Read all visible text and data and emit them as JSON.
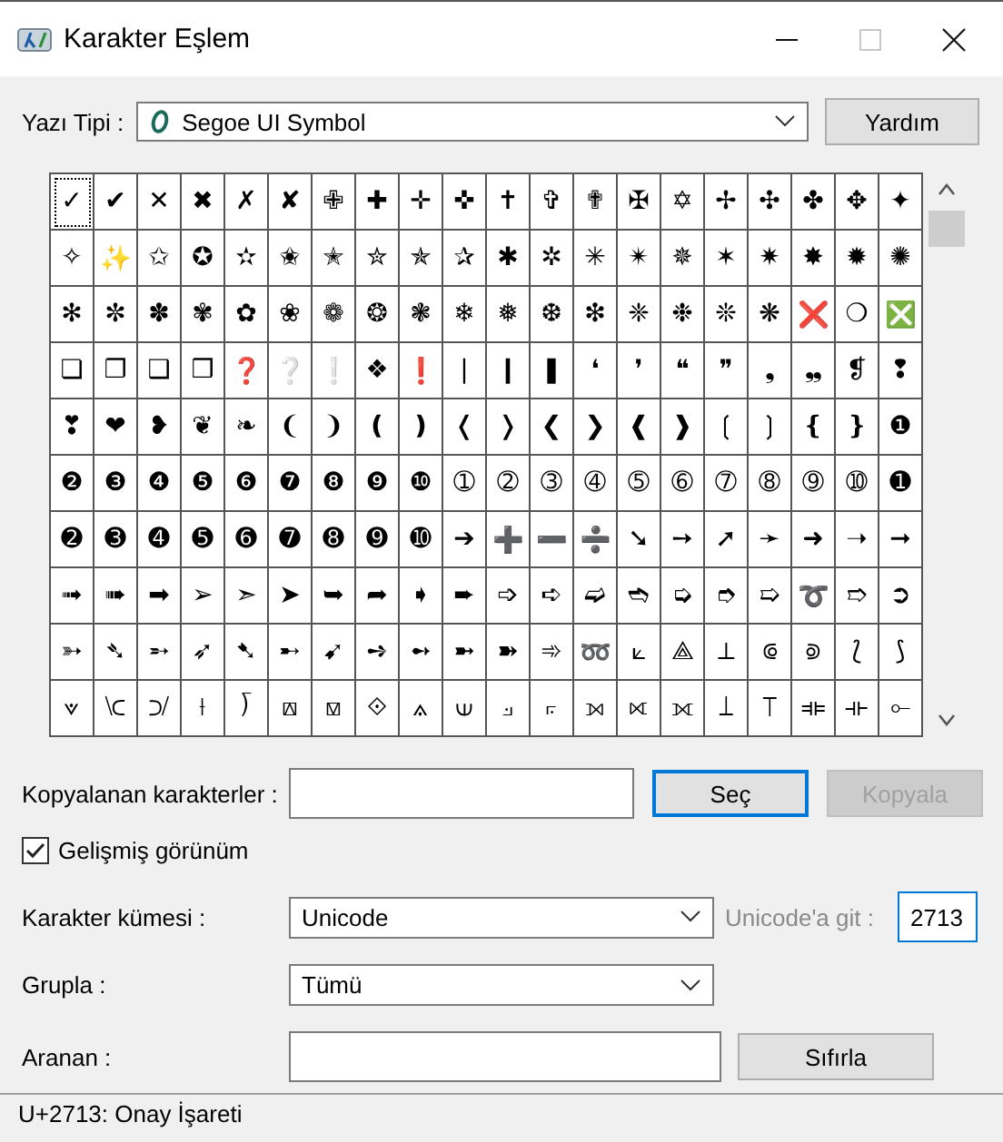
{
  "window": {
    "title": "Karakter Eşlem"
  },
  "font": {
    "label": "Yazı Tipi :",
    "value": "Segoe UI Symbol",
    "help_button": "Yardım"
  },
  "grid": [
    [
      {
        "char": "✓",
        "selected": true
      },
      {
        "char": "✔",
        "selected": false
      },
      {
        "char": "✕",
        "selected": false
      },
      {
        "char": "✖",
        "selected": false
      },
      {
        "char": "✗",
        "selected": false
      },
      {
        "char": "✘",
        "selected": false
      },
      {
        "char": "✙",
        "selected": false
      },
      {
        "char": "✚",
        "selected": false
      },
      {
        "char": "✛",
        "selected": false
      },
      {
        "char": "✜",
        "selected": false
      },
      {
        "char": "✝",
        "selected": false
      },
      {
        "char": "✞",
        "selected": false
      },
      {
        "char": "✟",
        "selected": false
      },
      {
        "char": "✠",
        "selected": false
      },
      {
        "char": "✡",
        "selected": false
      },
      {
        "char": "✢",
        "selected": false
      },
      {
        "char": "✣",
        "selected": false
      },
      {
        "char": "✤",
        "selected": false
      },
      {
        "char": "✥",
        "selected": false
      },
      {
        "char": "✦",
        "selected": false
      }
    ],
    [
      {
        "char": "✧",
        "selected": false
      },
      {
        "char": "✨",
        "selected": false
      },
      {
        "char": "✩",
        "selected": false
      },
      {
        "char": "✪",
        "selected": false
      },
      {
        "char": "✫",
        "selected": false
      },
      {
        "char": "✬",
        "selected": false
      },
      {
        "char": "✭",
        "selected": false
      },
      {
        "char": "✮",
        "selected": false
      },
      {
        "char": "✯",
        "selected": false
      },
      {
        "char": "✰",
        "selected": false
      },
      {
        "char": "✱",
        "selected": false
      },
      {
        "char": "✲",
        "selected": false
      },
      {
        "char": "✳",
        "selected": false
      },
      {
        "char": "✴",
        "selected": false
      },
      {
        "char": "✵",
        "selected": false
      },
      {
        "char": "✶",
        "selected": false
      },
      {
        "char": "✷",
        "selected": false
      },
      {
        "char": "✸",
        "selected": false
      },
      {
        "char": "✹",
        "selected": false
      },
      {
        "char": "✺",
        "selected": false
      }
    ],
    [
      {
        "char": "✻",
        "selected": false
      },
      {
        "char": "✼",
        "selected": false
      },
      {
        "char": "✽",
        "selected": false
      },
      {
        "char": "✾",
        "selected": false
      },
      {
        "char": "✿",
        "selected": false
      },
      {
        "char": "❀",
        "selected": false
      },
      {
        "char": "❁",
        "selected": false
      },
      {
        "char": "❂",
        "selected": false
      },
      {
        "char": "❃",
        "selected": false
      },
      {
        "char": "❄",
        "selected": false
      },
      {
        "char": "❅",
        "selected": false
      },
      {
        "char": "❆",
        "selected": false
      },
      {
        "char": "❇",
        "selected": false
      },
      {
        "char": "❈",
        "selected": false
      },
      {
        "char": "❉",
        "selected": false
      },
      {
        "char": "❊",
        "selected": false
      },
      {
        "char": "❋",
        "selected": false
      },
      {
        "char": "❌",
        "selected": false
      },
      {
        "char": "❍",
        "selected": false
      },
      {
        "char": "❎",
        "selected": false
      }
    ],
    [
      {
        "char": "❏",
        "selected": false
      },
      {
        "char": "❐",
        "selected": false
      },
      {
        "char": "❑",
        "selected": false
      },
      {
        "char": "❒",
        "selected": false
      },
      {
        "char": "❓",
        "selected": false
      },
      {
        "char": "❔",
        "selected": false
      },
      {
        "char": "❕",
        "selected": false
      },
      {
        "char": "❖",
        "selected": false
      },
      {
        "char": "❗",
        "selected": false
      },
      {
        "char": "❘",
        "selected": false
      },
      {
        "char": "❙",
        "selected": false
      },
      {
        "char": "❚",
        "selected": false
      },
      {
        "char": "❛",
        "selected": false
      },
      {
        "char": "❜",
        "selected": false
      },
      {
        "char": "❝",
        "selected": false
      },
      {
        "char": "❞",
        "selected": false
      },
      {
        "char": "❟",
        "selected": false
      },
      {
        "char": "❠",
        "selected": false
      },
      {
        "char": "❡",
        "selected": false
      },
      {
        "char": "❢",
        "selected": false
      }
    ],
    [
      {
        "char": "❣",
        "selected": false
      },
      {
        "char": "❤",
        "selected": false
      },
      {
        "char": "❥",
        "selected": false
      },
      {
        "char": "❦",
        "selected": false
      },
      {
        "char": "❧",
        "selected": false
      },
      {
        "char": "❨",
        "selected": false
      },
      {
        "char": "❩",
        "selected": false
      },
      {
        "char": "❪",
        "selected": false
      },
      {
        "char": "❫",
        "selected": false
      },
      {
        "char": "❬",
        "selected": false
      },
      {
        "char": "❭",
        "selected": false
      },
      {
        "char": "❮",
        "selected": false
      },
      {
        "char": "❯",
        "selected": false
      },
      {
        "char": "❰",
        "selected": false
      },
      {
        "char": "❱",
        "selected": false
      },
      {
        "char": "❲",
        "selected": false
      },
      {
        "char": "❳",
        "selected": false
      },
      {
        "char": "❴",
        "selected": false
      },
      {
        "char": "❵",
        "selected": false
      },
      {
        "char": "❶",
        "selected": false
      }
    ],
    [
      {
        "char": "❷",
        "selected": false
      },
      {
        "char": "❸",
        "selected": false
      },
      {
        "char": "❹",
        "selected": false
      },
      {
        "char": "❺",
        "selected": false
      },
      {
        "char": "❻",
        "selected": false
      },
      {
        "char": "❼",
        "selected": false
      },
      {
        "char": "❽",
        "selected": false
      },
      {
        "char": "❾",
        "selected": false
      },
      {
        "char": "❿",
        "selected": false
      },
      {
        "char": "➀",
        "selected": false
      },
      {
        "char": "➁",
        "selected": false
      },
      {
        "char": "➂",
        "selected": false
      },
      {
        "char": "➃",
        "selected": false
      },
      {
        "char": "➄",
        "selected": false
      },
      {
        "char": "➅",
        "selected": false
      },
      {
        "char": "➆",
        "selected": false
      },
      {
        "char": "➇",
        "selected": false
      },
      {
        "char": "➈",
        "selected": false
      },
      {
        "char": "➉",
        "selected": false
      },
      {
        "char": "➊",
        "selected": false
      }
    ],
    [
      {
        "char": "➋",
        "selected": false
      },
      {
        "char": "➌",
        "selected": false
      },
      {
        "char": "➍",
        "selected": false
      },
      {
        "char": "➎",
        "selected": false
      },
      {
        "char": "➏",
        "selected": false
      },
      {
        "char": "➐",
        "selected": false
      },
      {
        "char": "➑",
        "selected": false
      },
      {
        "char": "➒",
        "selected": false
      },
      {
        "char": "➓",
        "selected": false
      },
      {
        "char": "➔",
        "selected": false
      },
      {
        "char": "➕",
        "selected": false
      },
      {
        "char": "➖",
        "selected": false
      },
      {
        "char": "➗",
        "selected": false
      },
      {
        "char": "➘",
        "selected": false
      },
      {
        "char": "➙",
        "selected": false
      },
      {
        "char": "➚",
        "selected": false
      },
      {
        "char": "➛",
        "selected": false
      },
      {
        "char": "➜",
        "selected": false
      },
      {
        "char": "➝",
        "selected": false
      },
      {
        "char": "➞",
        "selected": false
      }
    ],
    [
      {
        "char": "➟",
        "selected": false
      },
      {
        "char": "➠",
        "selected": false
      },
      {
        "char": "➡",
        "selected": false
      },
      {
        "char": "➢",
        "selected": false
      },
      {
        "char": "➣",
        "selected": false
      },
      {
        "char": "➤",
        "selected": false
      },
      {
        "char": "➥",
        "selected": false
      },
      {
        "char": "➦",
        "selected": false
      },
      {
        "char": "➧",
        "selected": false
      },
      {
        "char": "➨",
        "selected": false
      },
      {
        "char": "➩",
        "selected": false
      },
      {
        "char": "➪",
        "selected": false
      },
      {
        "char": "➫",
        "selected": false
      },
      {
        "char": "➬",
        "selected": false
      },
      {
        "char": "➭",
        "selected": false
      },
      {
        "char": "➮",
        "selected": false
      },
      {
        "char": "➯",
        "selected": false
      },
      {
        "char": "➰",
        "selected": false
      },
      {
        "char": "➱",
        "selected": false
      },
      {
        "char": "➲",
        "selected": false
      }
    ],
    [
      {
        "char": "➳",
        "selected": false
      },
      {
        "char": "➴",
        "selected": false
      },
      {
        "char": "➵",
        "selected": false
      },
      {
        "char": "➶",
        "selected": false
      },
      {
        "char": "➷",
        "selected": false
      },
      {
        "char": "➸",
        "selected": false
      },
      {
        "char": "➹",
        "selected": false
      },
      {
        "char": "➺",
        "selected": false
      },
      {
        "char": "➻",
        "selected": false
      },
      {
        "char": "➼",
        "selected": false
      },
      {
        "char": "➽",
        "selected": false
      },
      {
        "char": "➾",
        "selected": false
      },
      {
        "char": "➿",
        "selected": false
      },
      {
        "char": "⟀",
        "selected": false
      },
      {
        "char": "⟁",
        "selected": false
      },
      {
        "char": "⟂",
        "selected": false
      },
      {
        "char": "⟃",
        "selected": false
      },
      {
        "char": "⟄",
        "selected": false
      },
      {
        "char": "⟅",
        "selected": false
      },
      {
        "char": "⟆",
        "selected": false
      }
    ],
    [
      {
        "char": "⟇",
        "selected": false
      },
      {
        "char": "⟈",
        "selected": false
      },
      {
        "char": "⟉",
        "selected": false
      },
      {
        "char": "⟊",
        "selected": false
      },
      {
        "char": "⟌",
        "selected": false
      },
      {
        "char": "⟎",
        "selected": false
      },
      {
        "char": "⟏",
        "selected": false
      },
      {
        "char": "⟐",
        "selected": false
      },
      {
        "char": "⟑",
        "selected": false
      },
      {
        "char": "⟒",
        "selected": false
      },
      {
        "char": "⟓",
        "selected": false
      },
      {
        "char": "⟔",
        "selected": false
      },
      {
        "char": "⟕",
        "selected": false
      },
      {
        "char": "⟖",
        "selected": false
      },
      {
        "char": "⟗",
        "selected": false
      },
      {
        "char": "⟘",
        "selected": false
      },
      {
        "char": "⟙",
        "selected": false
      },
      {
        "char": "⟚",
        "selected": false
      },
      {
        "char": "⟛",
        "selected": false
      },
      {
        "char": "⟜",
        "selected": false
      }
    ]
  ],
  "copy": {
    "label": "Kopyalanan karakterler :",
    "select_button": "Seç",
    "copy_button": "Kopyala",
    "copy_disabled": true
  },
  "advanced_view": {
    "label": "Gelişmiş görünüm",
    "checked": true
  },
  "charset": {
    "label": "Karakter kümesi :",
    "value": "Unicode",
    "goto_label": "Unicode'a git :",
    "goto_disabled": true,
    "goto_value": "2713"
  },
  "group": {
    "label": "Grupla :",
    "value": "Tümü"
  },
  "search": {
    "label": "Aranan :",
    "button": "Sıfırla"
  },
  "status_bar": "U+2713: Onay İşareti"
}
